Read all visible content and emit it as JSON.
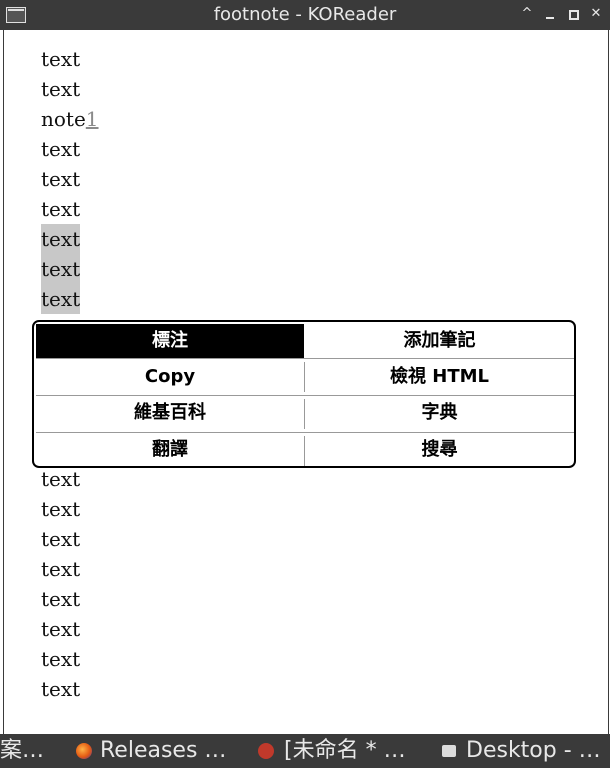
{
  "window": {
    "title": "footnote - KOReader"
  },
  "content": {
    "lines_before": [
      "text",
      "text"
    ],
    "note_line": {
      "text": "note",
      "footnote_ref": "1"
    },
    "lines_mid": [
      "text",
      "text",
      "text"
    ],
    "highlighted_lines": [
      "text",
      "text",
      "text"
    ],
    "lines_after": [
      "text",
      "text",
      "text",
      "text",
      "text",
      "text",
      "text",
      "text"
    ]
  },
  "popup_menu": {
    "highlight": "標注",
    "add_note": "添加筆記",
    "copy": "Copy",
    "view_html": "檢視 HTML",
    "wikipedia": "維基百科",
    "dictionary": "字典",
    "translate": "翻譯",
    "search": "搜尋"
  },
  "taskbar": {
    "items": [
      {
        "label": "案…",
        "icon": ""
      },
      {
        "label": "Releases …",
        "icon": "firefox-icon"
      },
      {
        "label": "[未命名 * …",
        "icon": "editor-icon"
      },
      {
        "label": "Desktop - …",
        "icon": "desktop-icon"
      }
    ]
  }
}
